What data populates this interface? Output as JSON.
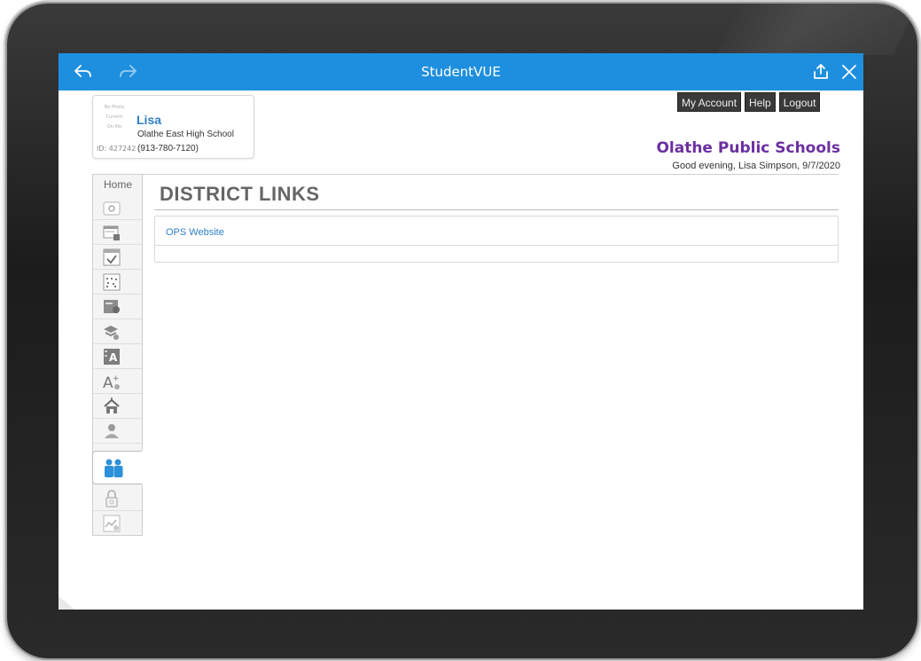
{
  "app": {
    "title": "StudentVUE"
  },
  "student": {
    "photo_placeholder": [
      "No Photo",
      "Current",
      "On file"
    ],
    "name": "Lisa",
    "school": "Olathe East High School",
    "phone": "(913-780-7120)",
    "id_label": "ID: 427242"
  },
  "header": {
    "buttons": [
      "My Account",
      "Help",
      "Logout"
    ],
    "district": "Olathe Public Schools",
    "greeting": "Good evening, Lisa Simpson, 9/7/2020"
  },
  "nav": {
    "home_label": "Home",
    "items": [
      "home",
      "calendar",
      "attendance",
      "class-schedule",
      "course-history",
      "course-request",
      "grade-book",
      "report-card",
      "school-info",
      "student-info",
      "district-links",
      "security",
      "test-history"
    ],
    "active": "district-links"
  },
  "main": {
    "page_title": "DISTRICT LINKS",
    "links": [
      "OPS Website"
    ]
  },
  "colors": {
    "appbar": "#1e8fde",
    "link": "#2e7fc9",
    "district": "#6b2fa0"
  }
}
